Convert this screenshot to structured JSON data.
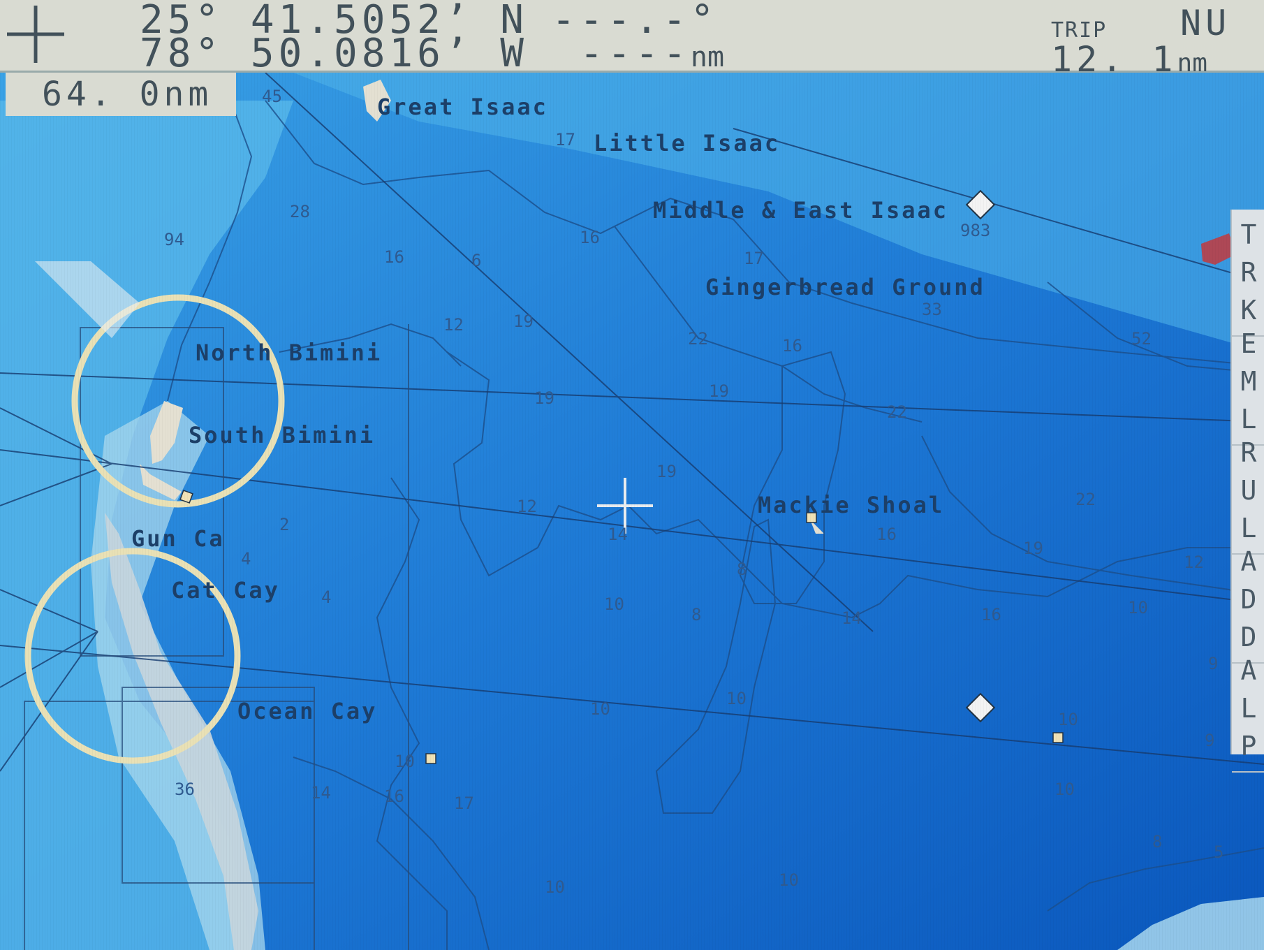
{
  "status_bar": {
    "latitude": "25° 41.5052’ N",
    "longitude": "78° 50.0816’ W",
    "bearing": "---.-°",
    "distance_value": "----",
    "distance_unit": "nm",
    "trip_label": "TRIP",
    "trip_value": "12. 1",
    "trip_unit": "nm",
    "orientation": "NU"
  },
  "range": "64. 0nm",
  "places": {
    "great_isaac": "Great Isaac",
    "little_isaac": "Little Isaac",
    "middle_east_isaac": "Middle & East Isaac",
    "gingerbread_ground": "Gingerbread Ground",
    "north_bimini": "North Bimini",
    "south_bimini": "South Bimini",
    "gun_cay": "Gun Ca",
    "cat_cay": "Cat Cay",
    "ocean_cay": "Ocean Cay",
    "mackie_shoal": "Mackie Shoal"
  },
  "soundings": [
    "45",
    "28",
    "94",
    "16",
    "6",
    "16",
    "12",
    "19",
    "22",
    "16",
    "19",
    "19",
    "22",
    "33",
    "52",
    "983",
    "17",
    "17",
    "19",
    "14",
    "12",
    "16",
    "19",
    "22",
    "12",
    "8",
    "8",
    "10",
    "14",
    "16",
    "10",
    "9",
    "10",
    "10",
    "10",
    "16",
    "14",
    "17",
    "10",
    "9",
    "8",
    "5",
    "2",
    "4",
    "4",
    "10",
    "36",
    "10",
    "10"
  ],
  "side_menu": [
    {
      "label": "TRK"
    },
    {
      "label": "EML"
    },
    {
      "label": "RUL"
    },
    {
      "label": "ADD"
    },
    {
      "label": "ALP"
    }
  ],
  "colors": {
    "deep_water": "#0e5fc0",
    "mid_water": "#2a86da",
    "shallow_water": "#5cc0ea",
    "land": "#e4e0d2",
    "circle": "#e9e1b6"
  }
}
